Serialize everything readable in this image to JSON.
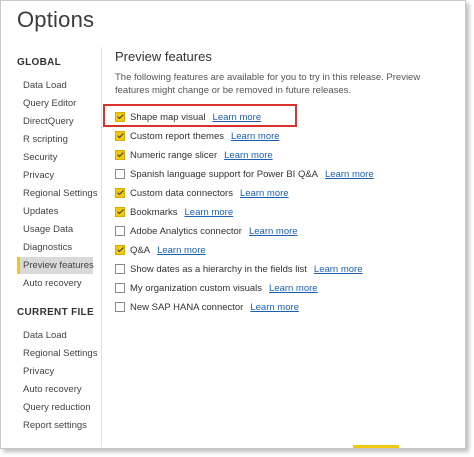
{
  "window": {
    "title": "Options"
  },
  "sidebar": {
    "global_header": "GLOBAL",
    "global_items": [
      {
        "label": "Data Load",
        "selected": false
      },
      {
        "label": "Query Editor",
        "selected": false
      },
      {
        "label": "DirectQuery",
        "selected": false
      },
      {
        "label": "R scripting",
        "selected": false
      },
      {
        "label": "Security",
        "selected": false
      },
      {
        "label": "Privacy",
        "selected": false
      },
      {
        "label": "Regional Settings",
        "selected": false
      },
      {
        "label": "Updates",
        "selected": false
      },
      {
        "label": "Usage Data",
        "selected": false
      },
      {
        "label": "Diagnostics",
        "selected": false
      },
      {
        "label": "Preview features",
        "selected": true
      },
      {
        "label": "Auto recovery",
        "selected": false
      }
    ],
    "current_header": "CURRENT FILE",
    "current_items": [
      {
        "label": "Data Load"
      },
      {
        "label": "Regional Settings"
      },
      {
        "label": "Privacy"
      },
      {
        "label": "Auto recovery"
      },
      {
        "label": "Query reduction"
      },
      {
        "label": "Report settings"
      }
    ]
  },
  "main": {
    "title": "Preview features",
    "description": "The following features are available for you to try in this release. Preview features might change or be removed in future releases.",
    "link_label": "Learn more",
    "features": [
      {
        "label": "Shape map visual",
        "checked": true
      },
      {
        "label": "Custom report themes",
        "checked": true
      },
      {
        "label": "Numeric range slicer",
        "checked": true
      },
      {
        "label": "Spanish language support for Power BI Q&A",
        "checked": false
      },
      {
        "label": "Custom data connectors",
        "checked": true
      },
      {
        "label": "Bookmarks",
        "checked": true
      },
      {
        "label": "Adobe Analytics connector",
        "checked": false
      },
      {
        "label": "Q&A",
        "checked": true
      },
      {
        "label": "Show dates as a hierarchy in the fields list",
        "checked": false
      },
      {
        "label": "My organization custom visuals",
        "checked": false
      },
      {
        "label": "New SAP HANA connector",
        "checked": false
      }
    ]
  },
  "colors": {
    "accent": "#f2c811",
    "link": "#1a5fb4",
    "highlight_border": "#d9322b",
    "selected_bg": "#d9d9d9"
  }
}
